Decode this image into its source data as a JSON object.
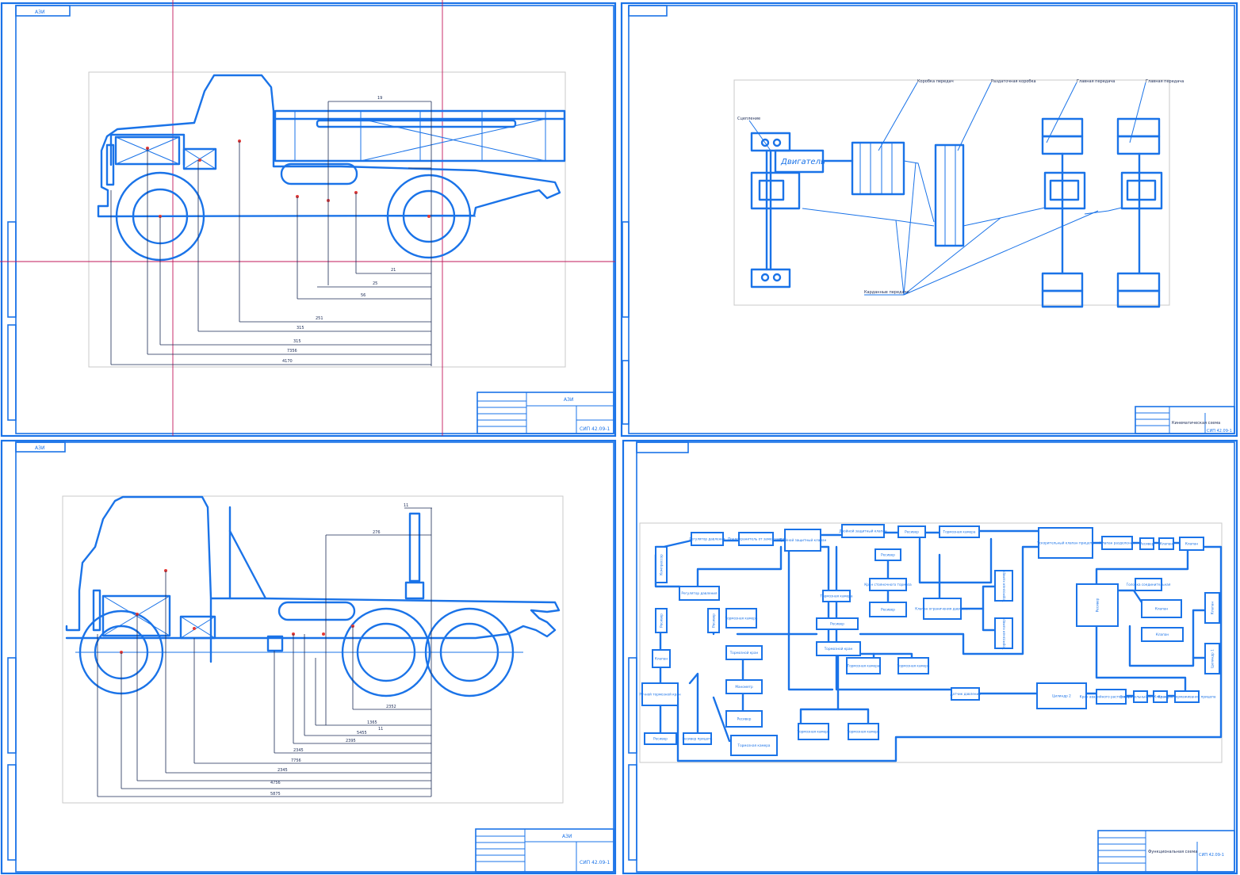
{
  "sheets": {
    "tl": {
      "stamp": "АЗИ",
      "scale": "",
      "code": "СИП 42.09-1"
    },
    "tr": {
      "stamp": "",
      "title_cell": "Кинематическая схема",
      "code": "СИП 42.09-1"
    },
    "bl": {
      "stamp": "АЗИ",
      "code": "СИП 42.09-1"
    },
    "br": {
      "title_cell": "Функциональная схема",
      "code": "СИП 42.09-1"
    }
  },
  "kinematic": {
    "engine": "Двигатель",
    "callouts": [
      "Сцепление",
      "Коробка передач",
      "Раздаточная коробка",
      "Главная передача",
      "Главная передача",
      "Карданные передачи"
    ]
  },
  "dims_tl": [
    "19",
    "21",
    "25",
    "56",
    "251",
    "315",
    "7356",
    "4170"
  ],
  "dims_bl": [
    "11",
    "276",
    "2352",
    "1365",
    "5455",
    "2395",
    "2345",
    "7756",
    "4756",
    "5875"
  ],
  "blocks": [
    "Регулятор давления",
    "Предохранитель от замерзания",
    "Тройной защитный клапан",
    "Двойной защитный клапан",
    "Ресивер",
    "Тормозная камера",
    "Ускорительный клапан прицепа",
    "Клапан разделения",
    "Ресивер",
    "Клапан",
    "Клапан",
    "Компрессор",
    "Ресивер",
    "Кран стояночного тормоза",
    "Ресивер",
    "Тормозная камера",
    "Клапан ограничения давления",
    "Тормозная камера",
    "Тормозная камера",
    "Ресивер",
    "Ресивер",
    "Тормозная камера",
    "Тормозной кран",
    "Ресивер",
    "Тормозной кран",
    "Манометр",
    "Ресивер",
    "Регулятор давления",
    "Тормозная камера",
    "Тормозная камера",
    "Клапан",
    "Ручной тормозной кран",
    "Датчик давления",
    "Тормозная камера",
    "Тормозная камера",
    "Ресивер",
    "Головка соединительная",
    "Клапан",
    "Клапан",
    "Клапан",
    "Цилиндр 1",
    "Цилиндр 2",
    "Кран аварийного растормаживания",
    "Ускорительный клапан",
    "Клапан",
    "Кран растормаживания прицепа",
    "Ресивер",
    "Ресивер прицепа",
    "Тормозная камера",
    "Тормозная камера",
    "Кран управления тормозами",
    "Клапан",
    "Клапан",
    "Клапан"
  ]
}
